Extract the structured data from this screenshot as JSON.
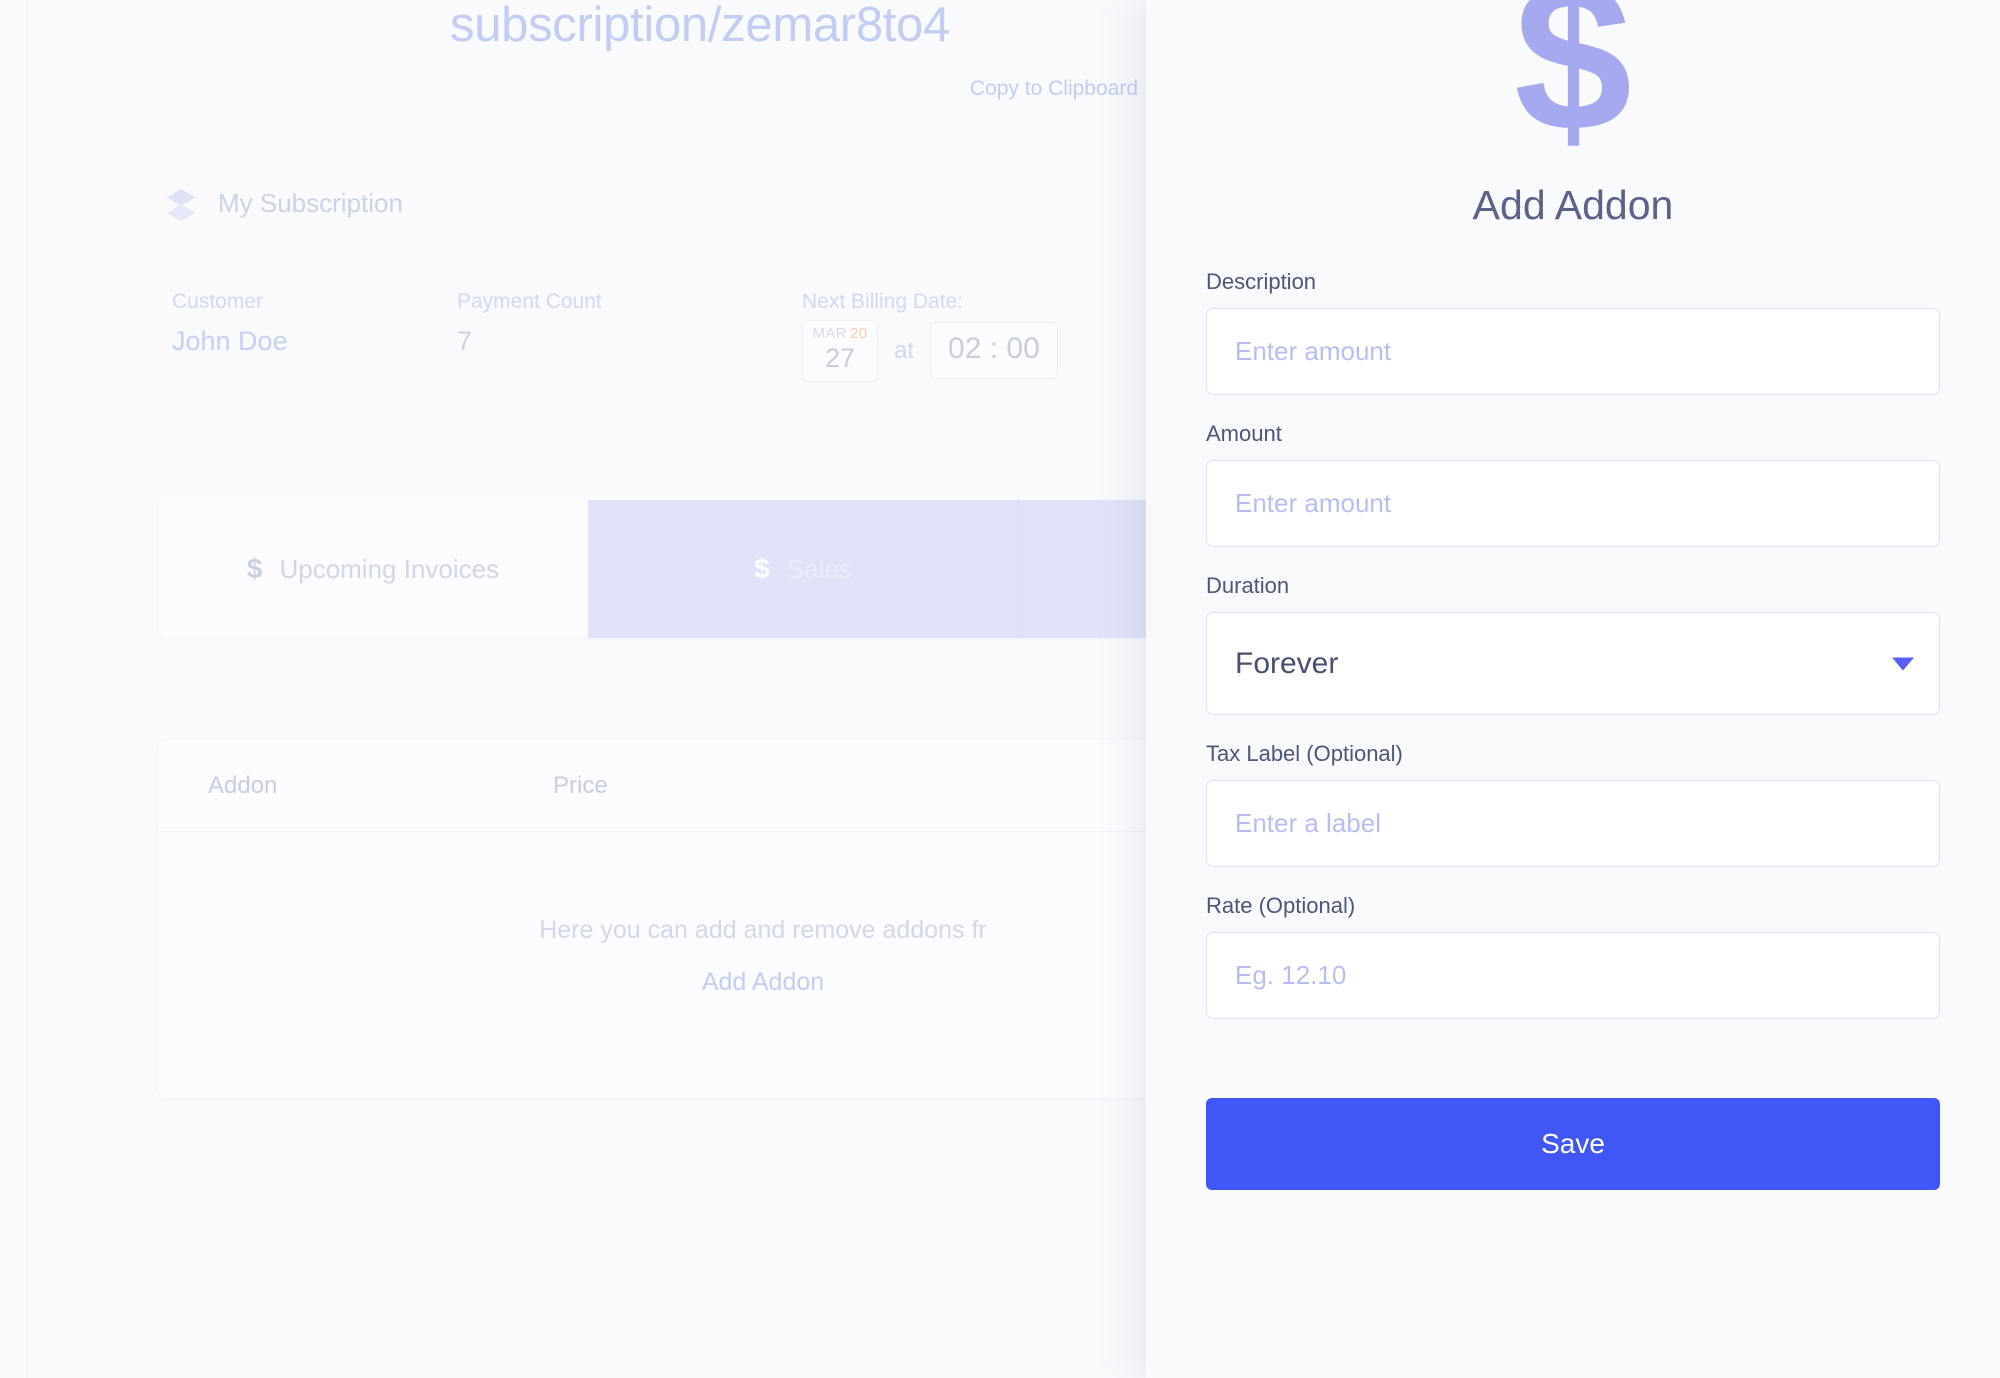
{
  "page": {
    "title": "subscription/zemar8to4",
    "copy_link": "Copy to Clipboard",
    "section_heading": "My Subscription",
    "layers_icon": "layers-icon"
  },
  "info": {
    "customer_label": "Customer",
    "customer_value": "John Doe",
    "payment_count_label": "Payment Count",
    "payment_count_value": "7",
    "billing_label": "Next Billing Date:",
    "billing_month": "MAR",
    "billing_year": "20",
    "billing_day": "27",
    "billing_at": "at",
    "billing_time": "02 : 00"
  },
  "tabs": [
    {
      "label": "Upcoming Invoices",
      "icon": "dollar-icon",
      "active": false
    },
    {
      "label": "Sales",
      "icon": "dollar-icon",
      "active": true
    }
  ],
  "addons_table": {
    "columns": [
      "Addon",
      "Price"
    ],
    "empty_text": "Here you can add and remove addons fr",
    "add_link": "Add Addon"
  },
  "modal": {
    "icon": "dollar-icon",
    "icon_glyph": "$",
    "title": "Add Addon",
    "fields": [
      {
        "label": "Description",
        "placeholder": "Enter amount",
        "value": "",
        "type": "text"
      },
      {
        "label": "Amount",
        "placeholder": "Enter amount",
        "value": "",
        "type": "text"
      },
      {
        "label": "Duration",
        "value": "Forever",
        "type": "select",
        "options": [
          "Forever"
        ]
      },
      {
        "label": "Tax Label (Optional)",
        "placeholder": "Enter a label",
        "value": "",
        "type": "text"
      },
      {
        "label": "Rate (Optional)",
        "placeholder": "Eg. 12.10",
        "value": "",
        "type": "text"
      }
    ],
    "save_label": "Save"
  },
  "colors": {
    "accent_blue": "#4156f6",
    "accent_purple": "#a7a9f0",
    "muted_lavender": "#c3cdf2",
    "tab_active_bg": "#e0e3f8",
    "page_bg": "#f8fafc",
    "date_year_orange": "#fbc9ad"
  }
}
